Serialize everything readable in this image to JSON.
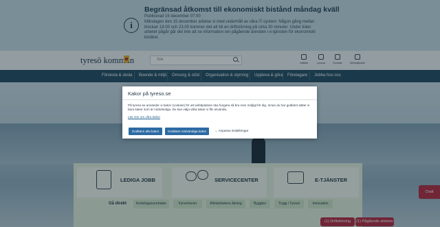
{
  "alert": {
    "icon": "info-icon",
    "title": "Begränsad åtkomst till ekonomiskt bistånd måndag kväll",
    "date": "Publicerad 15 december 07:00",
    "body": "Måndagen den 15 december arbetar vi med underhåll av våra IT-system. Någon gång mellan klockan 19.00 och 23.00 kommer det att bli en driftstörning på cirka 30 minuter. Under tiden arbetet pågår går det inte att se information om pågående ärenden i e-tjänsten för ekonomiskt bistånd."
  },
  "header": {
    "logo": "tyresö kommun",
    "search_placeholder": "Sök",
    "tools": [
      {
        "label": "Lättläst",
        "icon": "easy-read-icon"
      },
      {
        "label": "Lyssna",
        "icon": "listen-icon"
      },
      {
        "label": "Kontakt",
        "icon": "phone-icon"
      },
      {
        "label": "Webbtjänster",
        "icon": "web-services-icon"
      }
    ]
  },
  "nav": {
    "items": [
      "Förskola & skola",
      "Boende & miljö",
      "Omsorg & stöd",
      "Organisation & styrning",
      "Uppleva & göra",
      "Företagare",
      "Jobba hos oss"
    ]
  },
  "quick": {
    "cards": [
      {
        "label": "LEDIGA JOBB",
        "icon": "document-icon"
      },
      {
        "label": "SERVICECENTER",
        "icon": "people-chat-icon"
      },
      {
        "label": "E-TJÄNSTER",
        "icon": "computer-icon"
      }
    ],
    "goto_label": "Gå direkt",
    "links": [
      "Kretsloppscentralen",
      "Fyrverkerier",
      "Allmänhetens åkning",
      "Bygglov",
      "Trygg i Tyresö",
      "Innovation"
    ]
  },
  "footer": {
    "chat": "Chatt",
    "badges": [
      "(1) Driftstörning",
      "(1) Pågående arbeten"
    ]
  },
  "modal": {
    "title": "Kakor på tyreso.se",
    "text": "På tyreso.se använder vi kakor (cookies) för att webbplatsen ska fungera så bra som möjligt för dig. Innan du har godkänt sätter vi bara kakor som är nödvändiga. Du kan välja vilka kakor vi får använda.",
    "link": "Läs mer om våra kakor",
    "accept_all": "Godkänn alla kakor",
    "accept_necessary": "Godkänn nödvändiga kakor",
    "settings": "→ Anpassa inställningar"
  },
  "colors": {
    "nav_bg": "#1f4a61",
    "button": "#2c6aa3",
    "alert_bg": "#c4dbe6",
    "badge": "#b4283e"
  }
}
